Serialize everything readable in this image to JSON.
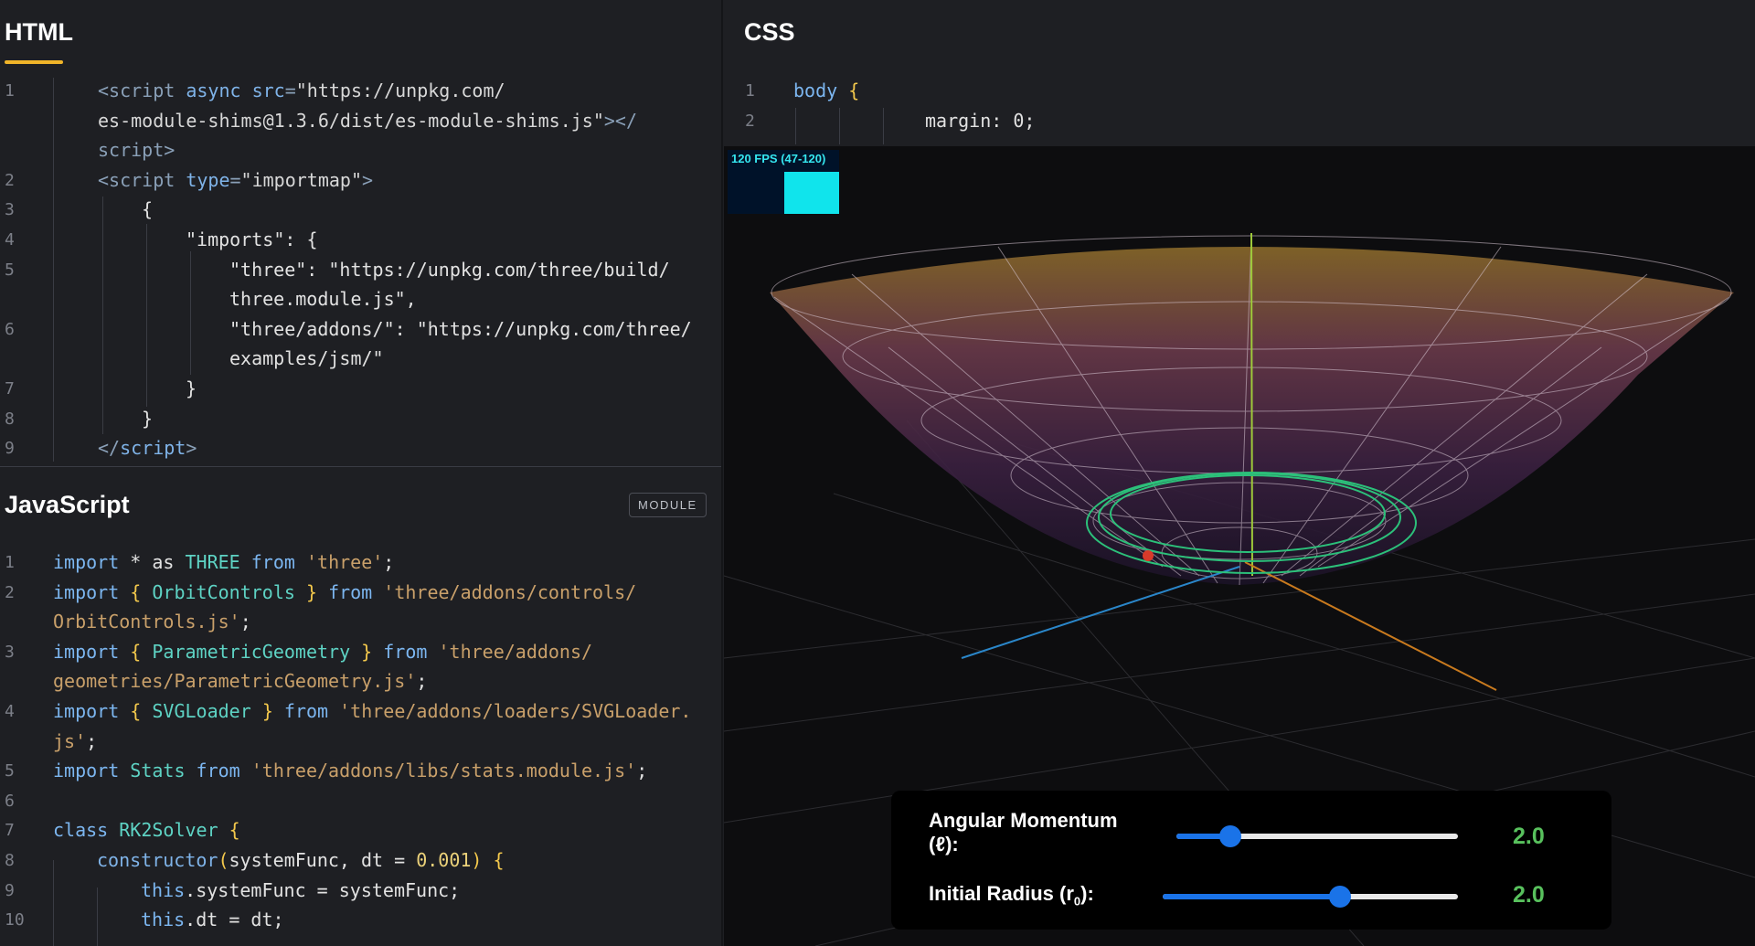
{
  "html_panel": {
    "title": "HTML",
    "lines": [
      {
        "n": "1",
        "t": [
          [
            "tag",
            "<script "
          ],
          [
            "attr",
            "async src"
          ],
          [
            "tag",
            "="
          ],
          [
            "str",
            "\"https://unpkg.com/"
          ]
        ]
      },
      {
        "n": "",
        "t": [
          [
            "str",
            "es-module-shims@1.3.6/dist/es-module-shims.js\""
          ],
          [
            "tag",
            "></"
          ]
        ]
      },
      {
        "n": "",
        "t": [
          [
            "tag",
            "script>"
          ]
        ]
      },
      {
        "n": "2",
        "t": [
          [
            "tag",
            "<script "
          ],
          [
            "attr",
            "type"
          ],
          [
            "tag",
            "="
          ],
          [
            "str",
            "\"importmap\""
          ],
          [
            "tag",
            ">"
          ]
        ]
      },
      {
        "n": "3",
        "t": [
          [
            "txt",
            "{"
          ]
        ]
      },
      {
        "n": "4",
        "t": [
          [
            "txt",
            "\"imports\": {"
          ]
        ]
      },
      {
        "n": "5",
        "t": [
          [
            "txt",
            "\"three\": \"https://unpkg.com/three/build/"
          ]
        ]
      },
      {
        "n": "",
        "t": [
          [
            "txt",
            "three.module.js\","
          ]
        ]
      },
      {
        "n": "6",
        "t": [
          [
            "txt",
            "\"three/addons/\": \"https://unpkg.com/three/"
          ]
        ]
      },
      {
        "n": "",
        "t": [
          [
            "txt",
            "examples/jsm/\""
          ]
        ]
      },
      {
        "n": "7",
        "t": [
          [
            "txt",
            "}"
          ]
        ]
      },
      {
        "n": "8",
        "t": [
          [
            "txt",
            "}"
          ]
        ]
      },
      {
        "n": "9",
        "t": [
          [
            "tag",
            "</"
          ],
          [
            "attr",
            "script"
          ],
          [
            "tag",
            ">"
          ]
        ]
      }
    ]
  },
  "css_panel": {
    "title": "CSS",
    "lines": [
      {
        "n": "1",
        "t": [
          [
            "kw",
            "body "
          ],
          [
            "brace",
            "{"
          ]
        ]
      },
      {
        "n": "2",
        "t": [
          [
            "txt",
            "margin: 0;"
          ]
        ]
      }
    ]
  },
  "js_panel": {
    "title": "JavaScript",
    "badge": "MODULE",
    "lines": [
      {
        "n": "1",
        "t": [
          [
            "kw",
            "import "
          ],
          [
            "txt",
            "* as "
          ],
          [
            "cls",
            "THREE "
          ],
          [
            "kw",
            "from "
          ],
          [
            "strg",
            "'three'"
          ],
          [
            "txt",
            ";"
          ]
        ]
      },
      {
        "n": "2",
        "t": [
          [
            "kw",
            "import "
          ],
          [
            "brace",
            "{ "
          ],
          [
            "cls",
            "OrbitControls "
          ],
          [
            "brace",
            "} "
          ],
          [
            "kw",
            "from "
          ],
          [
            "strg",
            "'three/addons/controls/"
          ]
        ]
      },
      {
        "n": "",
        "t": [
          [
            "strg",
            "OrbitControls.js'"
          ],
          [
            "txt",
            ";"
          ]
        ]
      },
      {
        "n": "3",
        "t": [
          [
            "kw",
            "import "
          ],
          [
            "brace",
            "{ "
          ],
          [
            "cls",
            "ParametricGeometry "
          ],
          [
            "brace",
            "} "
          ],
          [
            "kw",
            "from "
          ],
          [
            "strg",
            "'three/addons/"
          ]
        ]
      },
      {
        "n": "",
        "t": [
          [
            "strg",
            "geometries/ParametricGeometry.js'"
          ],
          [
            "txt",
            ";"
          ]
        ]
      },
      {
        "n": "4",
        "t": [
          [
            "kw",
            "import "
          ],
          [
            "brace",
            "{ "
          ],
          [
            "cls",
            "SVGLoader "
          ],
          [
            "brace",
            "} "
          ],
          [
            "kw",
            "from "
          ],
          [
            "strg",
            "'three/addons/loaders/SVGLoader."
          ]
        ]
      },
      {
        "n": "",
        "t": [
          [
            "strg",
            "js'"
          ],
          [
            "txt",
            ";"
          ]
        ]
      },
      {
        "n": "5",
        "t": [
          [
            "kw",
            "import "
          ],
          [
            "cls",
            "Stats "
          ],
          [
            "kw",
            "from "
          ],
          [
            "strg",
            "'three/addons/libs/stats.module.js'"
          ],
          [
            "txt",
            ";"
          ]
        ]
      },
      {
        "n": "6",
        "t": []
      },
      {
        "n": "7",
        "t": [
          [
            "kw",
            "class "
          ],
          [
            "cls",
            "RK2Solver "
          ],
          [
            "brace",
            "{"
          ]
        ]
      },
      {
        "n": "8",
        "t": [
          [
            "fn",
            "constructor"
          ],
          [
            "brace",
            "("
          ],
          [
            "txt",
            "systemFunc, dt = "
          ],
          [
            "num",
            "0.001"
          ],
          [
            "brace",
            ") {"
          ]
        ]
      },
      {
        "n": "9",
        "t": [
          [
            "kw",
            "this"
          ],
          [
            "txt",
            ".systemFunc = systemFunc;"
          ]
        ]
      },
      {
        "n": "10",
        "t": [
          [
            "kw",
            "this"
          ],
          [
            "txt",
            ".dt = dt;"
          ]
        ]
      }
    ]
  },
  "preview": {
    "fps_label": "120 FPS (47-120)",
    "controls": [
      {
        "label_line1": "Angular Momentum",
        "label_line2": "(ℓ):",
        "value": "2.0",
        "fraction": 0.19
      },
      {
        "label_line1": "Initial Radius (r",
        "label_sub": "0",
        "label_after": "):",
        "value": "2.0",
        "fraction": 0.6
      }
    ]
  },
  "colors": {
    "accent_underline": "#f0b429",
    "slider_blue": "#1a73e8",
    "value_green": "#58c15d",
    "fps_cyan": "#10e4ec"
  }
}
